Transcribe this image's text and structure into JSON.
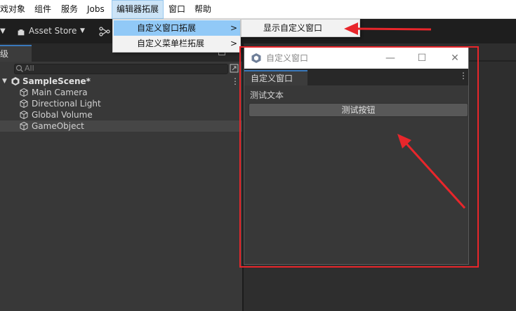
{
  "menubar": {
    "items": [
      {
        "label": "戏对象"
      },
      {
        "label": "组件"
      },
      {
        "label": "服务"
      },
      {
        "label": "Jobs"
      },
      {
        "label": "编辑器拓展"
      },
      {
        "label": "窗口"
      },
      {
        "label": "帮助"
      }
    ]
  },
  "toolbar": {
    "asset_store_label": "Asset Store"
  },
  "hierarchy": {
    "tab_label": "层级",
    "search_placeholder": "All",
    "scene_name": "SampleScene*",
    "objects": [
      {
        "label": "Main Camera"
      },
      {
        "label": "Directional Light"
      },
      {
        "label": "Global Volume"
      },
      {
        "label": "GameObject"
      }
    ]
  },
  "dropdown": {
    "items": [
      {
        "label": "自定义窗口拓展",
        "arrow": ">"
      },
      {
        "label": "自定义菜单栏拓展",
        "arrow": ">"
      }
    ],
    "submenu": {
      "items": [
        {
          "label": "显示自定义窗口"
        }
      ]
    }
  },
  "custom_window": {
    "title": "自定义窗口",
    "tab_label": "自定义窗口",
    "text": "测试文本",
    "button_label": "测试按钮",
    "controls": {
      "minimize": "—",
      "maximize": "☐",
      "close": "✕"
    }
  },
  "colors": {
    "annotation_red": "#e8262b",
    "menu_highlight": "#91c9f7",
    "tab_accent": "#3a79bb"
  }
}
